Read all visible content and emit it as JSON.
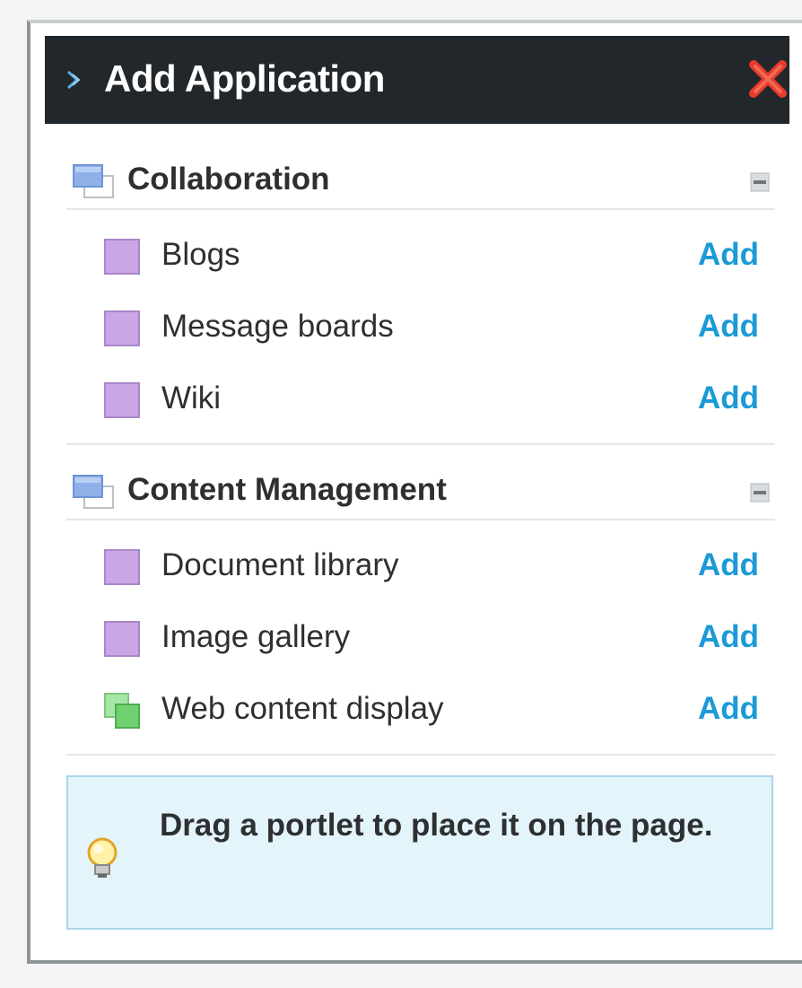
{
  "dialog": {
    "title": "Add Application",
    "close_icon": "close-icon",
    "expand_icon": "chevron-right-icon"
  },
  "categories": [
    {
      "label": "Collaboration",
      "icon": "category-folder-icon",
      "collapse_icon": "minus-icon",
      "apps": [
        {
          "label": "Blogs",
          "icon": "portlet-icon",
          "icon_color": "#c9a6e6",
          "action": "Add"
        },
        {
          "label": "Message boards",
          "icon": "portlet-icon",
          "icon_color": "#c9a6e6",
          "action": "Add"
        },
        {
          "label": "Wiki",
          "icon": "portlet-icon",
          "icon_color": "#c9a6e6",
          "action": "Add"
        }
      ]
    },
    {
      "label": "Content Management",
      "icon": "category-folder-icon",
      "collapse_icon": "minus-icon",
      "apps": [
        {
          "label": "Document library",
          "icon": "portlet-icon",
          "icon_color": "#c9a6e6",
          "action": "Add"
        },
        {
          "label": "Image gallery",
          "icon": "portlet-icon",
          "icon_color": "#c9a6e6",
          "action": "Add"
        },
        {
          "label": "Web content display",
          "icon": "web-content-icon",
          "icon_color": "#6fd16f",
          "action": "Add"
        }
      ]
    }
  ],
  "tip": {
    "icon": "lightbulb-icon",
    "text": "Drag a portlet to place it on the page."
  },
  "colors": {
    "titlebar_bg": "#22272b",
    "link": "#1a9ad6",
    "tip_bg": "#e4f4fb",
    "close_red": "#e53a2c"
  }
}
